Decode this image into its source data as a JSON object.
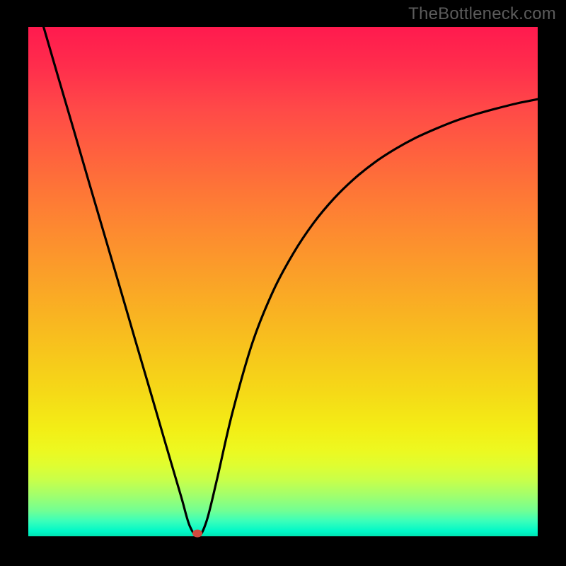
{
  "watermark": "TheBottleneck.com",
  "colors": {
    "page_bg": "#000000",
    "curve": "#000000",
    "marker": "#d14a3f",
    "watermark_text": "#5b5b5b"
  },
  "chart_data": {
    "type": "line",
    "title": "",
    "xlabel": "",
    "ylabel": "",
    "xlim": [
      0,
      100
    ],
    "ylim": [
      0,
      100
    ],
    "grid": false,
    "legend": false,
    "series": [
      {
        "name": "curve",
        "x": [
          3,
          6,
          9,
          12,
          15,
          18,
          21,
          24,
          27,
          30,
          31.7,
          33.4,
          35,
          37,
          40,
          44,
          48,
          52,
          56,
          60,
          64,
          68,
          72,
          76,
          80,
          84,
          88,
          92,
          96,
          100
        ],
        "values": [
          100,
          89.7,
          79.5,
          69.2,
          59,
          48.8,
          38.5,
          28.3,
          18,
          7.8,
          2,
          0,
          3,
          11,
          24,
          38,
          48,
          55.5,
          61.5,
          66.3,
          70.2,
          73.4,
          76,
          78.2,
          80,
          81.6,
          82.9,
          84,
          85,
          85.8
        ]
      }
    ],
    "marker": {
      "x": 33.2,
      "y": 0.5
    }
  }
}
